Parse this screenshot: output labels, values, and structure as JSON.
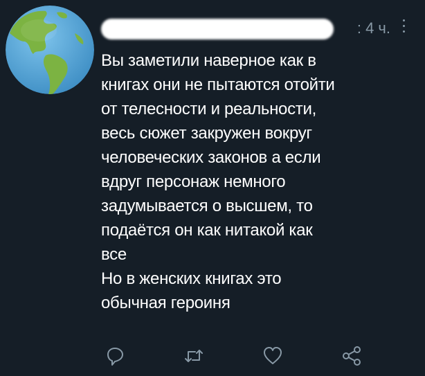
{
  "header": {
    "separator": ":",
    "time": "4 ч."
  },
  "tweet": {
    "lines": [
      "Вы заметили наверное как в",
      "книгах они не пытаются отойти",
      "от телесности и реальности,",
      "весь сюжет закружен вокруг",
      "человеческих законов а если",
      "вдруг персонаж немного",
      "задумывается о высшем, то",
      "подаётся он как нитакой как",
      "все",
      "Но в женских книгах это",
      "обычная героиня"
    ]
  },
  "actions": {
    "icons": [
      "reply-icon",
      "retweet-icon",
      "like-icon",
      "share-icon"
    ]
  },
  "colors": {
    "background": "#151e27",
    "text": "#ffffff",
    "secondary": "#8899a6",
    "globe_ocean": "#5aa9d8",
    "globe_land": "#7cb342"
  }
}
